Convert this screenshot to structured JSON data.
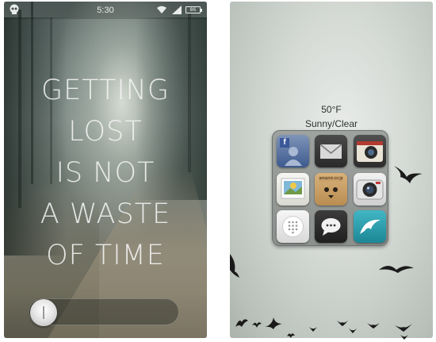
{
  "lock_screen": {
    "status_bar": {
      "time": "5:30",
      "battery_label": "86",
      "icons": [
        "skull-icon",
        "wifi-icon",
        "signal-icon",
        "battery-icon"
      ]
    },
    "quote_lines": [
      "GETTING",
      "LOST",
      "IS NOT",
      "A WASTE",
      "OF TIME"
    ],
    "unlock_slider": {
      "position": 0
    }
  },
  "home_screen": {
    "weather": {
      "temperature": "50°F",
      "condition": "Sunny/Clear"
    },
    "folder_apps": [
      {
        "name": "facebook-app-icon",
        "glyph": "f"
      },
      {
        "name": "mail-app-icon"
      },
      {
        "name": "retro-camera-app-icon"
      },
      {
        "name": "photo-gallery-app-icon"
      },
      {
        "name": "amazon-box-app-icon",
        "label": "amazon.co.jp"
      },
      {
        "name": "camera-app-icon"
      },
      {
        "name": "dialer-app-icon"
      },
      {
        "name": "messaging-app-icon"
      },
      {
        "name": "dolphin-browser-app-icon"
      }
    ]
  },
  "colors": {
    "quote_text": "#f5f5f5",
    "weather_text": "#2e3330",
    "folder_bg": "#9fa3a0",
    "bird": "#1a1a1a"
  }
}
